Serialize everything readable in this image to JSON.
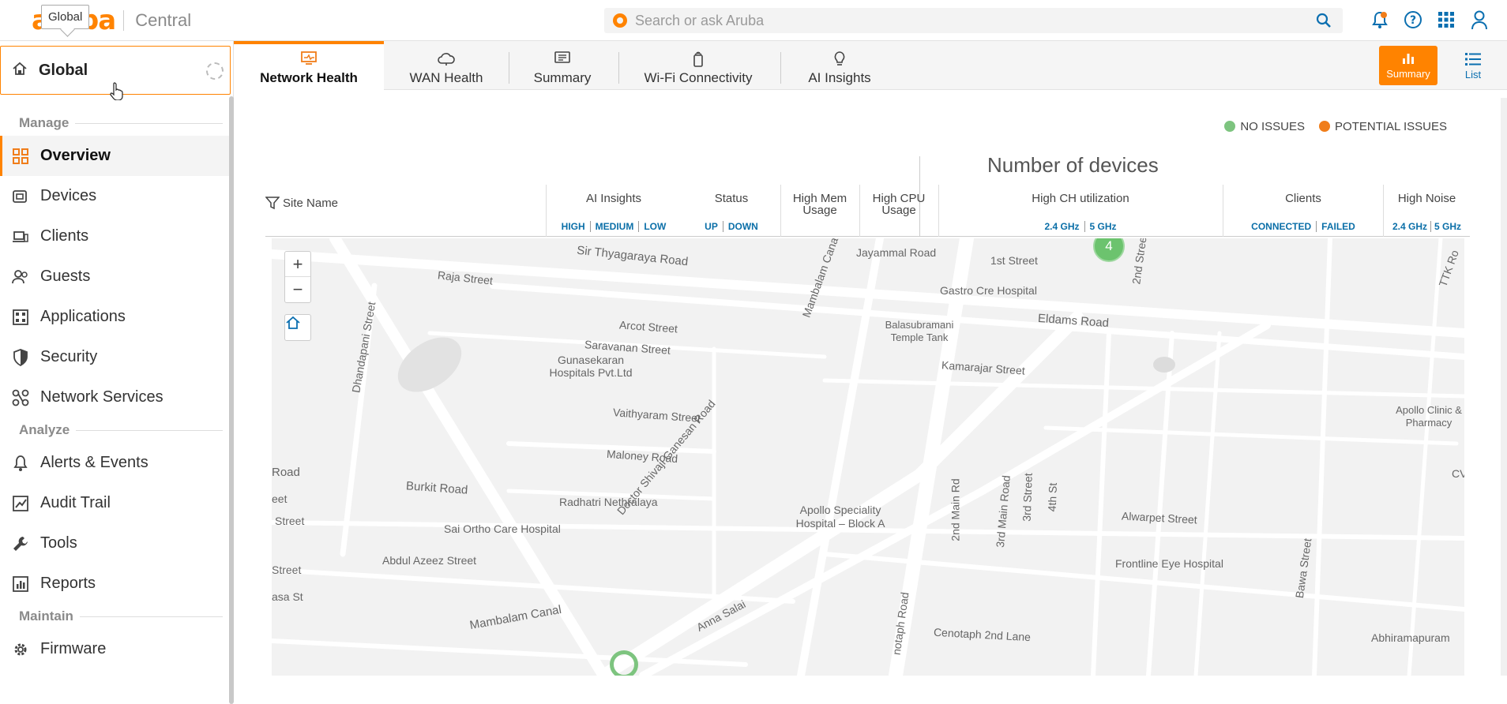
{
  "header": {
    "logo_mark": "aruba",
    "logo_text": "Central",
    "tooltip": "Global",
    "search_placeholder": "Search or ask Aruba",
    "icons": [
      "search-icon",
      "notification-bell-icon",
      "help-icon",
      "apps-grid-icon",
      "user-icon"
    ]
  },
  "sidebar": {
    "scope_title": "Global",
    "sections": [
      {
        "label": "Manage",
        "items": [
          {
            "label": "Overview",
            "icon": "overview-grid-icon",
            "active": true
          },
          {
            "label": "Devices",
            "icon": "devices-icon"
          },
          {
            "label": "Clients",
            "icon": "clients-icon"
          },
          {
            "label": "Guests",
            "icon": "guests-icon"
          },
          {
            "label": "Applications",
            "icon": "applications-icon"
          },
          {
            "label": "Security",
            "icon": "shield-icon"
          },
          {
            "label": "Network Services",
            "icon": "network-services-icon"
          }
        ]
      },
      {
        "label": "Analyze",
        "items": [
          {
            "label": "Alerts & Events",
            "icon": "bell-icon"
          },
          {
            "label": "Audit Trail",
            "icon": "audit-trail-icon"
          },
          {
            "label": "Tools",
            "icon": "wrench-icon"
          },
          {
            "label": "Reports",
            "icon": "reports-icon"
          }
        ]
      },
      {
        "label": "Maintain",
        "items": [
          {
            "label": "Firmware",
            "icon": "gear-icon"
          }
        ]
      }
    ]
  },
  "tabs": [
    {
      "label": "Network Health",
      "icon": "monitor-icon",
      "active": true
    },
    {
      "label": "WAN Health",
      "icon": "cloud-icon"
    },
    {
      "label": "Summary",
      "icon": "summary-icon"
    },
    {
      "label": "Wi-Fi Connectivity",
      "icon": "wifi-device-icon"
    },
    {
      "label": "AI Insights",
      "icon": "lightbulb-icon"
    }
  ],
  "view_buttons": {
    "summary": "Summary",
    "list": "List"
  },
  "legend": {
    "no_issues": "NO ISSUES",
    "potential_issues": "POTENTIAL ISSUES",
    "colors": {
      "no_issues": "#7dc47f",
      "potential_issues": "#f07d1a"
    }
  },
  "table": {
    "group_title": "Number of devices",
    "site_name": "Site Name",
    "columns": [
      {
        "title": "AI Insights",
        "sub": [
          "HIGH",
          "MEDIUM",
          "LOW"
        ]
      },
      {
        "title": "Status",
        "sub": [
          "UP",
          "DOWN"
        ]
      },
      {
        "title": "High Mem Usage",
        "sub": []
      },
      {
        "title": "High CPU Usage",
        "sub": []
      },
      {
        "title": "High CH utilization",
        "sub": [
          "2.4 GHz",
          "5 GHz"
        ]
      },
      {
        "title": "Clients",
        "sub": [
          "CONNECTED",
          "FAILED"
        ]
      },
      {
        "title": "High Noise",
        "sub": [
          "2.4 GHz",
          "5 GHz"
        ]
      }
    ]
  },
  "map": {
    "cluster_count": "4",
    "labels": [
      "Sir Thyagaraya Road",
      "Raja Street",
      "Jayammal Road",
      "1st Street",
      "Gastro Cre Hospital",
      "Mambalam Canal",
      "2nd Stree",
      "TTK Ro",
      "Dhandapani Street",
      "Arcot Street",
      "Saravanan Street",
      "Balasubramani Temple Tank",
      "Eldams Road",
      "Gunasekaran Hospitals Pvt.Ltd",
      "Kamarajar Street",
      "Vaithyaram Street",
      "Apollo Clinic & Pharmacy",
      "Maloney Road",
      "Doctor Shivaji Ganesan Road",
      "Burkit Road",
      "Radhatri Nethralaya",
      "Apollo Speciality Hospital – Block A",
      "2nd Main Rd",
      "3rd Main Road",
      "3rd Street",
      "4th St",
      "Alwarpet Street",
      "Sai Ortho Care Hospital",
      "Abdul Azeez Street",
      "Frontline Eye Hospital",
      "Bawa Street",
      "Mambalam Canal",
      "Anna Salai",
      "notaph Road",
      "Cenotaph 2nd Lane",
      "Abhiramapuram",
      "Road",
      "eet",
      "Street",
      "Street",
      "asa St",
      "CV"
    ]
  }
}
